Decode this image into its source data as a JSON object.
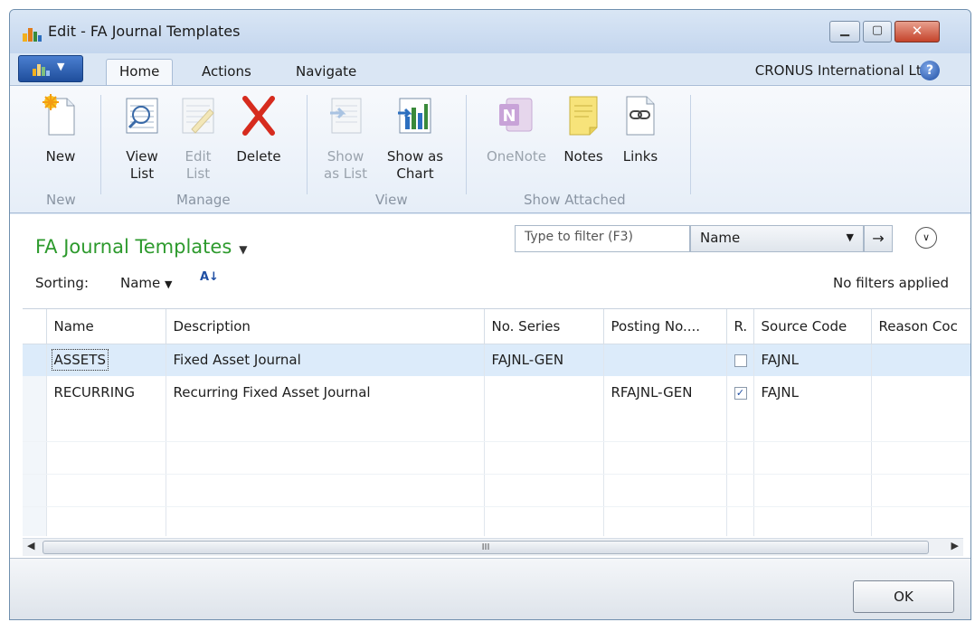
{
  "window": {
    "title": "Edit - FA Journal Templates"
  },
  "ribbon": {
    "tabs": [
      {
        "label": "Home",
        "active": true
      },
      {
        "label": "Actions",
        "active": false
      },
      {
        "label": "Navigate",
        "active": false
      }
    ],
    "company": "CRONUS International Ltd.",
    "groups": {
      "new": {
        "label": "New",
        "buttons": {
          "new": "New"
        }
      },
      "manage": {
        "label": "Manage",
        "buttons": {
          "view_list": "View List",
          "edit_list": "Edit List",
          "delete": "Delete"
        }
      },
      "view": {
        "label": "View",
        "buttons": {
          "show_as_list": "Show as List",
          "show_as_chart": "Show as Chart"
        }
      },
      "show_attached": {
        "label": "Show Attached",
        "buttons": {
          "onenote": "OneNote",
          "notes": "Notes",
          "links": "Links"
        }
      }
    }
  },
  "page": {
    "title": "FA Journal Templates",
    "filter_placeholder": "Type to filter (F3)",
    "filter_field": "Name",
    "sorting_label": "Sorting:",
    "sort_field": "Name",
    "filters_status": "No filters applied"
  },
  "grid": {
    "columns": [
      "Name",
      "Description",
      "No. Series",
      "Posting No....",
      "R.",
      "Source Code",
      "Reason Coc"
    ],
    "rows": [
      {
        "name": "ASSETS",
        "description": "Fixed Asset Journal",
        "no_series": "FAJNL-GEN",
        "posting_no_series": "",
        "recurring": false,
        "source_code": "FAJNL",
        "reason_code": ""
      },
      {
        "name": "RECURRING",
        "description": "Recurring Fixed Asset Journal",
        "no_series": "",
        "posting_no_series": "RFAJNL-GEN",
        "recurring": true,
        "source_code": "FAJNL",
        "reason_code": ""
      }
    ],
    "scroll_marker": "III"
  },
  "footer": {
    "ok_label": "OK"
  },
  "colors": {
    "title_green": "#2d9a2d",
    "selection": "#dcebfa",
    "app_button": "#1f4e9c",
    "close_button": "#c5432b"
  }
}
